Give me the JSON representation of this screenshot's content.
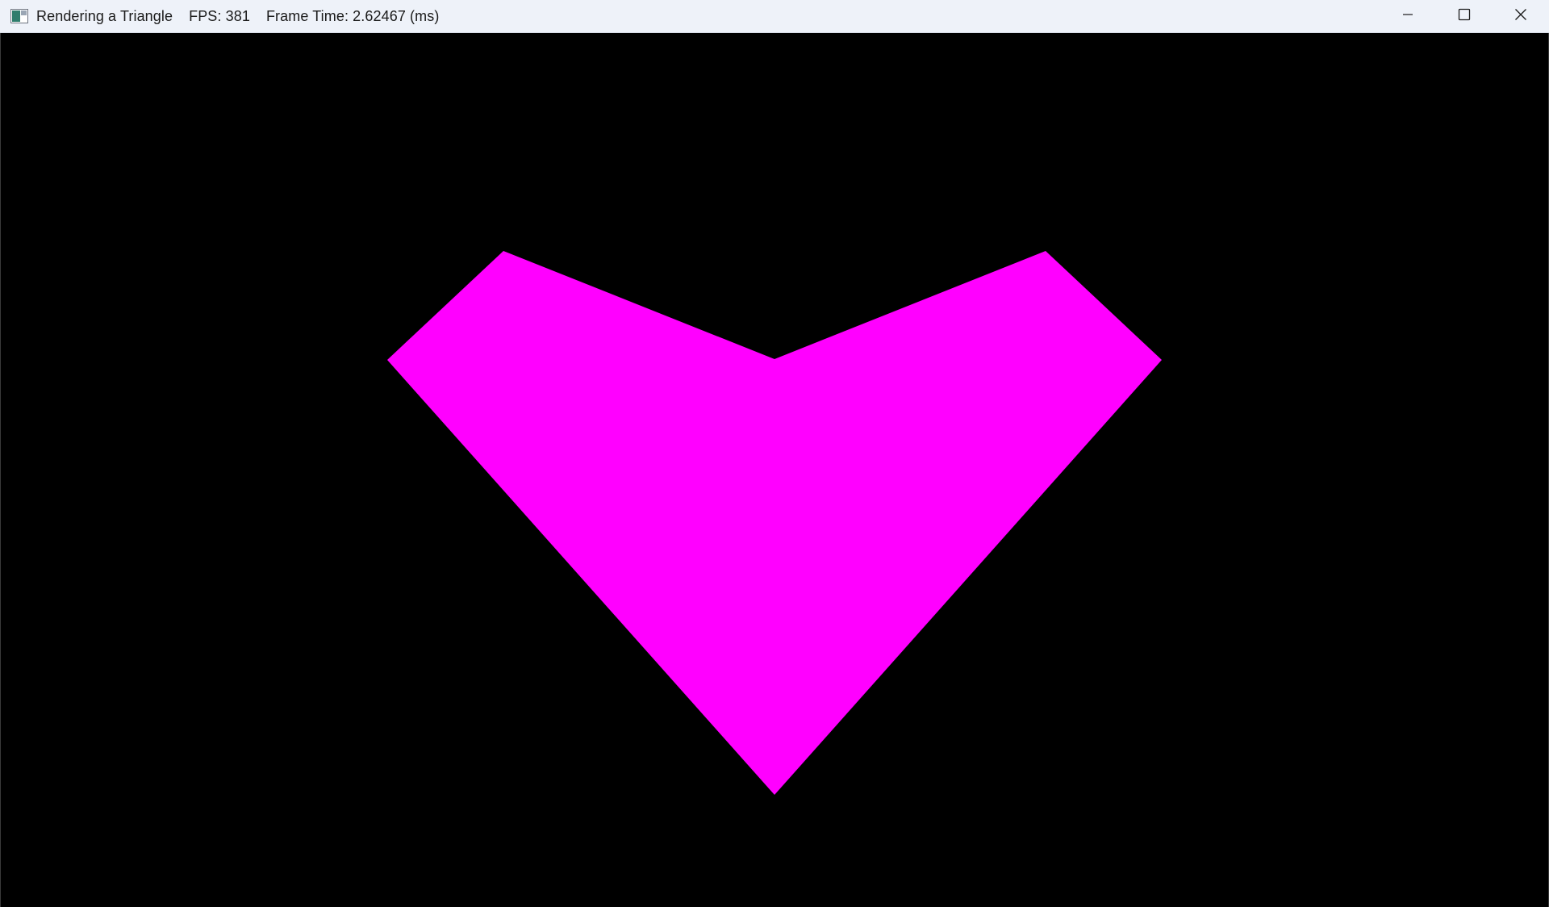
{
  "window": {
    "title": "Rendering a Triangle",
    "fps": "FPS: 381",
    "frame_time": "Frame Time: 2.62467 (ms)",
    "icon": "app-window-icon",
    "controls": {
      "minimize_icon": "minimize-icon",
      "maximize_icon": "maximize-icon",
      "close_icon": "close-icon"
    }
  },
  "scene": {
    "background_color": "#000000",
    "shape_color": "#ff00ff",
    "shape": "heart-shaped polygon"
  }
}
